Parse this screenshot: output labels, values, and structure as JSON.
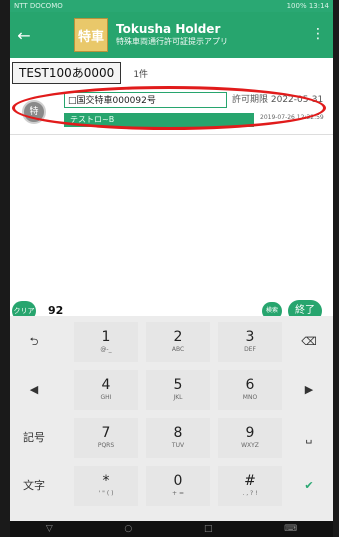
{
  "status_bar": {
    "left_text": "NTT DOCOMO",
    "right_text": "100% 13:14"
  },
  "app_bar": {
    "back_glyph": "←",
    "logo_text": "特車",
    "title": "Tokusha Holder",
    "subtitle": "特殊車両通行許可証提示アプリ",
    "menu_glyph": "⋮"
  },
  "plate": {
    "number": "TEST100あ0000",
    "count": "1件"
  },
  "record": {
    "badge": "特",
    "permit_number": "□国交特車000092号",
    "permit_label_date": "許可期限 2022-05-31",
    "tag": "テストロ~B",
    "updated": "2019-07-26 12:32:59"
  },
  "search": {
    "clear_label": "クリア",
    "value": "92",
    "search_label": "検索",
    "end_label": "終了"
  },
  "keyboard": {
    "side_left": [
      "⮌",
      "◀",
      "記号",
      "文字"
    ],
    "side_right": [
      "⌫",
      "▶",
      "␣",
      "✔"
    ],
    "keys": [
      {
        "main": "1",
        "sub": "@-_"
      },
      {
        "main": "2",
        "sub": "ABC"
      },
      {
        "main": "3",
        "sub": "DEF"
      },
      {
        "main": "4",
        "sub": "GHI"
      },
      {
        "main": "5",
        "sub": "JKL"
      },
      {
        "main": "6",
        "sub": "MNO"
      },
      {
        "main": "7",
        "sub": "PQRS"
      },
      {
        "main": "8",
        "sub": "TUV"
      },
      {
        "main": "9",
        "sub": "WXYZ"
      },
      {
        "main": "*",
        "sub": "' \" ( )"
      },
      {
        "main": "0",
        "sub": "+ ="
      },
      {
        "main": "#",
        "sub": ". , ? !"
      }
    ]
  },
  "nav_bar": {
    "back": "▽",
    "home": "○",
    "recents": "□",
    "keyboard": "⌨"
  },
  "colors": {
    "accent": "#27a56e",
    "ring": "#e11b1b"
  }
}
